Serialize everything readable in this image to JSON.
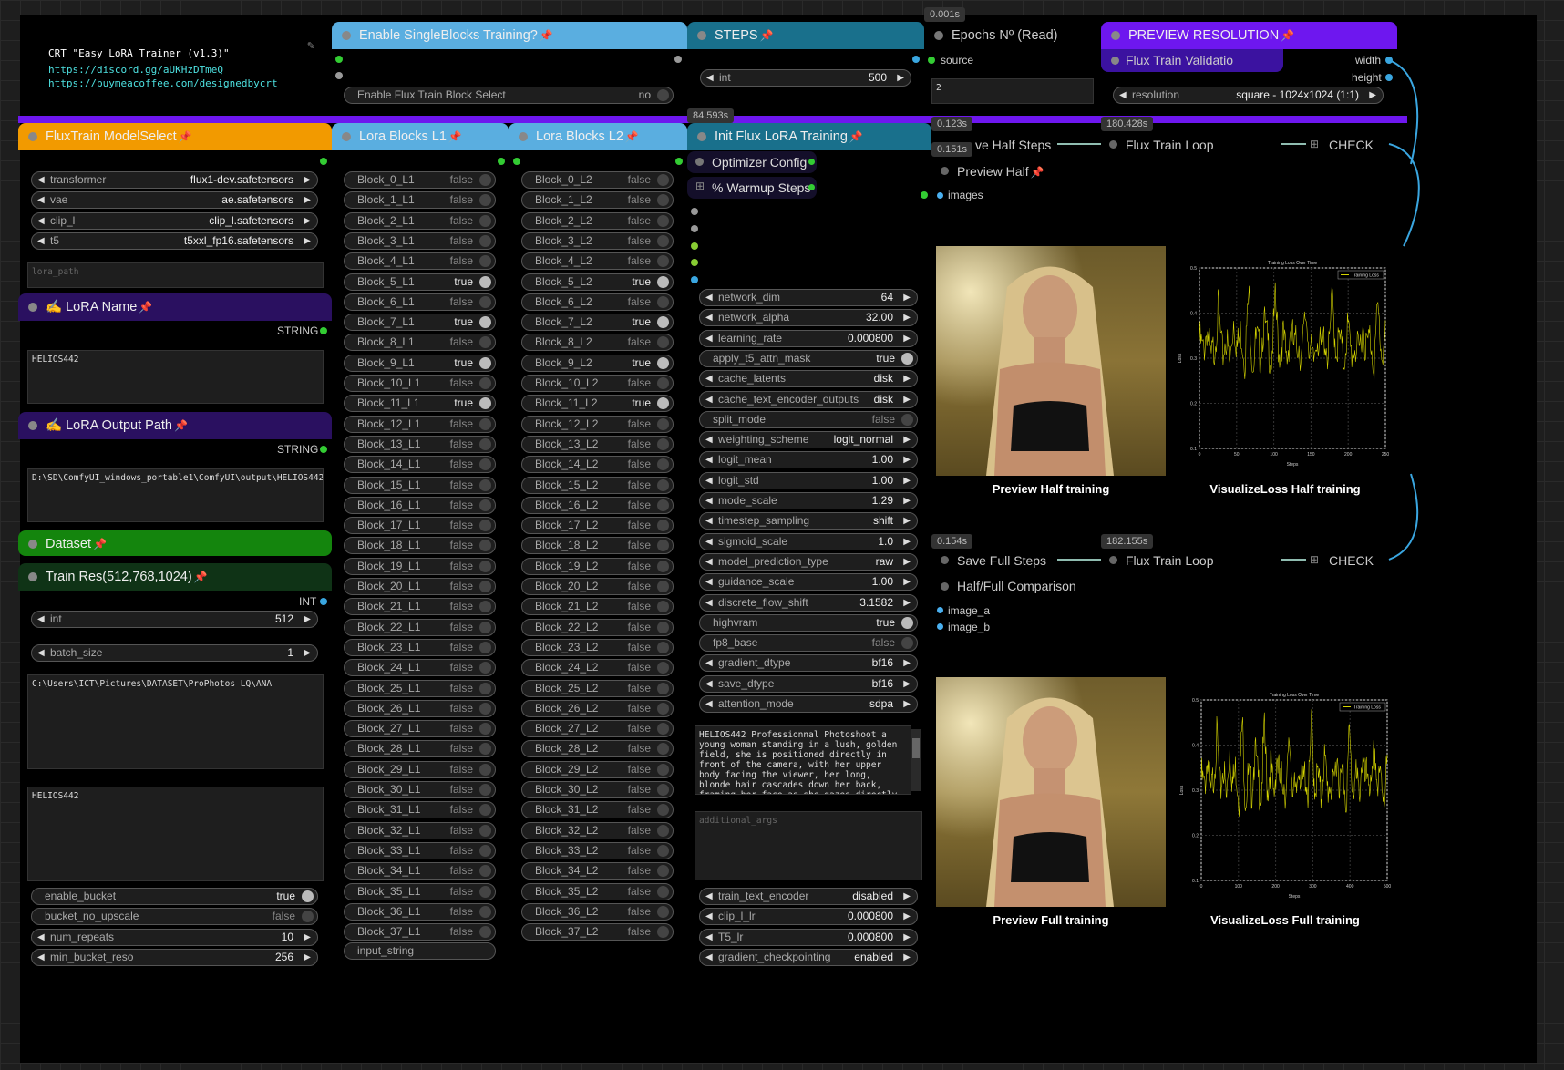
{
  "info": {
    "title": "CRT \"Easy LoRA Trainer (v1.3)\"",
    "link1": "https://discord.gg/aUKHzDTmeQ",
    "link2": "https://buymeacoffee.com/designedbycrt"
  },
  "timers": {
    "t1": "0.001s",
    "t2": "84.593s",
    "t3": "0.123s",
    "t4": "0.151s",
    "t5": "180.428s",
    "t6": "0.154s",
    "t7": "182.155s"
  },
  "singleblocks": {
    "title": "Enable SingleBlocks Training?",
    "select_label": "Enable Flux Train Block Select",
    "select_value": "no"
  },
  "steps": {
    "title": "STEPS",
    "label": "int",
    "value": "500"
  },
  "epochs": {
    "title": "Epochs Nº (Read)",
    "source": "source",
    "value": "2"
  },
  "preview_res": {
    "title": "PREVIEW RESOLUTION",
    "sub": "Flux Train Validatio",
    "width": "width",
    "height": "height",
    "res_label": "resolution",
    "res_value": "square - 1024x1024 (1:1)"
  },
  "modelselect": {
    "title": "FluxTrain ModelSelect",
    "rows": [
      {
        "label": "transformer",
        "value": "flux1-dev.safetensors"
      },
      {
        "label": "vae",
        "value": "ae.safetensors"
      },
      {
        "label": "clip_l",
        "value": "clip_l.safetensors"
      },
      {
        "label": "t5",
        "value": "t5xxl_fp16.safetensors"
      }
    ],
    "lora_path": "lora_path"
  },
  "lora_name": {
    "title": "LoRA Name",
    "type": "STRING",
    "value": "HELIOS442"
  },
  "lora_output": {
    "title": "LoRA Output Path",
    "type": "STRING",
    "value": "D:\\SD\\ComfyUI_windows_portable1\\ComfyUI\\output\\HELIOS442"
  },
  "dataset": {
    "title": "Dataset"
  },
  "trainres": {
    "title": "Train Res(512,768,1024)",
    "type": "INT",
    "int_label": "int",
    "int_value": "512",
    "batch_label": "batch_size",
    "batch_value": "1",
    "path": "C:\\Users\\ICT\\Pictures\\DATASET\\ProPhotos LQ\\ANA",
    "trigger": "HELIOS442",
    "enable_bucket": "enable_bucket",
    "enable_bucket_v": "true",
    "bucket_no_upscale": "bucket_no_upscale",
    "bucket_no_upscale_v": "false",
    "num_repeats": "num_repeats",
    "num_repeats_v": "10",
    "min_bucket_reso": "min_bucket_reso",
    "min_bucket_reso_v": "256"
  },
  "blocks_l1": {
    "title": "Lora Blocks L1",
    "input": "input_string",
    "items": [
      {
        "l": "Block_0_L1",
        "v": "false"
      },
      {
        "l": "Block_1_L1",
        "v": "false"
      },
      {
        "l": "Block_2_L1",
        "v": "false"
      },
      {
        "l": "Block_3_L1",
        "v": "false"
      },
      {
        "l": "Block_4_L1",
        "v": "false"
      },
      {
        "l": "Block_5_L1",
        "v": "true"
      },
      {
        "l": "Block_6_L1",
        "v": "false"
      },
      {
        "l": "Block_7_L1",
        "v": "true"
      },
      {
        "l": "Block_8_L1",
        "v": "false"
      },
      {
        "l": "Block_9_L1",
        "v": "true"
      },
      {
        "l": "Block_10_L1",
        "v": "false"
      },
      {
        "l": "Block_11_L1",
        "v": "true"
      },
      {
        "l": "Block_12_L1",
        "v": "false"
      },
      {
        "l": "Block_13_L1",
        "v": "false"
      },
      {
        "l": "Block_14_L1",
        "v": "false"
      },
      {
        "l": "Block_15_L1",
        "v": "false"
      },
      {
        "l": "Block_16_L1",
        "v": "false"
      },
      {
        "l": "Block_17_L1",
        "v": "false"
      },
      {
        "l": "Block_18_L1",
        "v": "false"
      },
      {
        "l": "Block_19_L1",
        "v": "false"
      },
      {
        "l": "Block_20_L1",
        "v": "false"
      },
      {
        "l": "Block_21_L1",
        "v": "false"
      },
      {
        "l": "Block_22_L1",
        "v": "false"
      },
      {
        "l": "Block_23_L1",
        "v": "false"
      },
      {
        "l": "Block_24_L1",
        "v": "false"
      },
      {
        "l": "Block_25_L1",
        "v": "false"
      },
      {
        "l": "Block_26_L1",
        "v": "false"
      },
      {
        "l": "Block_27_L1",
        "v": "false"
      },
      {
        "l": "Block_28_L1",
        "v": "false"
      },
      {
        "l": "Block_29_L1",
        "v": "false"
      },
      {
        "l": "Block_30_L1",
        "v": "false"
      },
      {
        "l": "Block_31_L1",
        "v": "false"
      },
      {
        "l": "Block_32_L1",
        "v": "false"
      },
      {
        "l": "Block_33_L1",
        "v": "false"
      },
      {
        "l": "Block_34_L1",
        "v": "false"
      },
      {
        "l": "Block_35_L1",
        "v": "false"
      },
      {
        "l": "Block_36_L1",
        "v": "false"
      },
      {
        "l": "Block_37_L1",
        "v": "false"
      }
    ]
  },
  "blocks_l2": {
    "title": "Lora Blocks L2",
    "items": [
      {
        "l": "Block_0_L2",
        "v": "false"
      },
      {
        "l": "Block_1_L2",
        "v": "false"
      },
      {
        "l": "Block_2_L2",
        "v": "false"
      },
      {
        "l": "Block_3_L2",
        "v": "false"
      },
      {
        "l": "Block_4_L2",
        "v": "false"
      },
      {
        "l": "Block_5_L2",
        "v": "true"
      },
      {
        "l": "Block_6_L2",
        "v": "false"
      },
      {
        "l": "Block_7_L2",
        "v": "true"
      },
      {
        "l": "Block_8_L2",
        "v": "false"
      },
      {
        "l": "Block_9_L2",
        "v": "true"
      },
      {
        "l": "Block_10_L2",
        "v": "false"
      },
      {
        "l": "Block_11_L2",
        "v": "true"
      },
      {
        "l": "Block_12_L2",
        "v": "false"
      },
      {
        "l": "Block_13_L2",
        "v": "false"
      },
      {
        "l": "Block_14_L2",
        "v": "false"
      },
      {
        "l": "Block_15_L2",
        "v": "false"
      },
      {
        "l": "Block_16_L2",
        "v": "false"
      },
      {
        "l": "Block_17_L2",
        "v": "false"
      },
      {
        "l": "Block_18_L2",
        "v": "false"
      },
      {
        "l": "Block_19_L2",
        "v": "false"
      },
      {
        "l": "Block_20_L2",
        "v": "false"
      },
      {
        "l": "Block_21_L2",
        "v": "false"
      },
      {
        "l": "Block_22_L2",
        "v": "false"
      },
      {
        "l": "Block_23_L2",
        "v": "false"
      },
      {
        "l": "Block_24_L2",
        "v": "false"
      },
      {
        "l": "Block_25_L2",
        "v": "false"
      },
      {
        "l": "Block_26_L2",
        "v": "false"
      },
      {
        "l": "Block_27_L2",
        "v": "false"
      },
      {
        "l": "Block_28_L2",
        "v": "false"
      },
      {
        "l": "Block_29_L2",
        "v": "false"
      },
      {
        "l": "Block_30_L2",
        "v": "false"
      },
      {
        "l": "Block_31_L2",
        "v": "false"
      },
      {
        "l": "Block_32_L2",
        "v": "false"
      },
      {
        "l": "Block_33_L2",
        "v": "false"
      },
      {
        "l": "Block_34_L2",
        "v": "false"
      },
      {
        "l": "Block_35_L2",
        "v": "false"
      },
      {
        "l": "Block_36_L2",
        "v": "false"
      },
      {
        "l": "Block_37_L2",
        "v": "false"
      }
    ]
  },
  "init": {
    "title": "Init Flux LoRA Training",
    "optimizer": "Optimizer Config",
    "warmup": "% Warmup Steps",
    "params": [
      {
        "l": "network_dim",
        "v": "64",
        "t": "num"
      },
      {
        "l": "network_alpha",
        "v": "32.00",
        "t": "num"
      },
      {
        "l": "learning_rate",
        "v": "0.000800",
        "t": "num"
      },
      {
        "l": "apply_t5_attn_mask",
        "v": "true",
        "t": "bool"
      },
      {
        "l": "cache_latents",
        "v": "disk",
        "t": "num"
      },
      {
        "l": "cache_text_encoder_outputs",
        "v": "disk",
        "t": "num"
      },
      {
        "l": "split_mode",
        "v": "false",
        "t": "bool"
      },
      {
        "l": "weighting_scheme",
        "v": "logit_normal",
        "t": "num"
      },
      {
        "l": "logit_mean",
        "v": "1.00",
        "t": "num"
      },
      {
        "l": "logit_std",
        "v": "1.00",
        "t": "num"
      },
      {
        "l": "mode_scale",
        "v": "1.29",
        "t": "num"
      },
      {
        "l": "timestep_sampling",
        "v": "shift",
        "t": "num"
      },
      {
        "l": "sigmoid_scale",
        "v": "1.0",
        "t": "num"
      },
      {
        "l": "model_prediction_type",
        "v": "raw",
        "t": "num"
      },
      {
        "l": "guidance_scale",
        "v": "1.00",
        "t": "num"
      },
      {
        "l": "discrete_flow_shift",
        "v": "3.1582",
        "t": "num"
      },
      {
        "l": "highvram",
        "v": "true",
        "t": "bool"
      },
      {
        "l": "fp8_base",
        "v": "false",
        "t": "bool"
      },
      {
        "l": "gradient_dtype",
        "v": "bf16",
        "t": "num"
      },
      {
        "l": "save_dtype",
        "v": "bf16",
        "t": "num"
      },
      {
        "l": "attention_mode",
        "v": "sdpa",
        "t": "num"
      }
    ],
    "prompt": "HELIOS442 Professionnal Photoshoot a young woman standing in a lush, golden field, she is positioned directly in front of the camera, with her upper body facing the viewer, her long, blonde hair cascades down her back, framing her face as she gazes directly at the viewer with a neutral",
    "additional": "additional_args",
    "params2": [
      {
        "l": "train_text_encoder",
        "v": "disabled"
      },
      {
        "l": "clip_l_lr",
        "v": "0.000800"
      },
      {
        "l": "T5_lr",
        "v": "0.000800"
      },
      {
        "l": "gradient_checkpointing",
        "v": "enabled"
      }
    ]
  },
  "half": {
    "save": "Save Half Steps",
    "save_visible": "ve Half Steps",
    "loop": "Flux Train Loop",
    "check": "CHECK",
    "preview": "Preview Half",
    "images": "images",
    "cap1": "Preview Half training",
    "cap2": "VisualizeLoss Half training",
    "chart_title": "Training Loss Over Time",
    "legend": "Training Loss",
    "ylabel": "Loss",
    "xlabel": "Steps"
  },
  "full": {
    "save": "Save Full Steps",
    "loop": "Flux Train Loop",
    "check": "CHECK",
    "compare": "Half/Full Comparison",
    "image_a": "image_a",
    "image_b": "image_b",
    "cap1": "Preview Full training",
    "cap2": "VisualizeLoss Full training"
  },
  "chart_data": [
    {
      "type": "line",
      "title": "Training Loss Over Time",
      "legend": [
        "Training Loss"
      ],
      "xlabel": "Steps",
      "ylabel": "Loss",
      "xlim": [
        0,
        250
      ],
      "ylim": [
        0.1,
        0.5
      ],
      "xticks": [
        "0",
        "50",
        "100",
        "150",
        "200",
        "250"
      ],
      "yticks": [
        "0.1",
        "0.2",
        "0.3",
        "0.4",
        "0.5"
      ],
      "series": [
        {
          "name": "Training Loss",
          "values": [
            0.34,
            0.31,
            0.37,
            0.29,
            0.33,
            0.41,
            0.3,
            0.35,
            0.28,
            0.39,
            0.32,
            0.36,
            0.3,
            0.44,
            0.29,
            0.34,
            0.31,
            0.38,
            0.33,
            0.3,
            0.42,
            0.31,
            0.35,
            0.29,
            0.37,
            0.32,
            0.34,
            0.3,
            0.4,
            0.33,
            0.28,
            0.36,
            0.31,
            0.35,
            0.3,
            0.43,
            0.32,
            0.34,
            0.29,
            0.37,
            0.31,
            0.33,
            0.3,
            0.38,
            0.32,
            0.35,
            0.29,
            0.41,
            0.31,
            0.34
          ]
        }
      ]
    },
    {
      "type": "line",
      "title": "Training Loss Over Time",
      "legend": [
        "Training Loss"
      ],
      "xlabel": "Steps",
      "ylabel": "Loss",
      "xlim": [
        0,
        500
      ],
      "ylim": [
        0.1,
        0.5
      ],
      "xticks": [
        "0",
        "100",
        "200",
        "300",
        "400",
        "500"
      ],
      "yticks": [
        "0.1",
        "0.2",
        "0.3",
        "0.4",
        "0.5"
      ],
      "series": [
        {
          "name": "Training Loss",
          "values": [
            0.33,
            0.3,
            0.38,
            0.28,
            0.34,
            0.42,
            0.29,
            0.36,
            0.27,
            0.4,
            0.31,
            0.35,
            0.29,
            0.45,
            0.28,
            0.33,
            0.3,
            0.39,
            0.32,
            0.29,
            0.43,
            0.3,
            0.36,
            0.28,
            0.38,
            0.31,
            0.33,
            0.29,
            0.41,
            0.32,
            0.27,
            0.37,
            0.3,
            0.34,
            0.29,
            0.44,
            0.31,
            0.33,
            0.28,
            0.38,
            0.3,
            0.32,
            0.29,
            0.39,
            0.31,
            0.34,
            0.28,
            0.42,
            0.3,
            0.33,
            0.29,
            0.37,
            0.31,
            0.35,
            0.28,
            0.4,
            0.3,
            0.33,
            0.29,
            0.36
          ]
        }
      ]
    }
  ],
  "colors": {
    "purple": "#6e17ef",
    "blue_hdr": "#5aaee0",
    "teal_hdr": "#19708c",
    "orange_hdr": "#f29a00",
    "green_hdr": "#14850d",
    "dark_purple": "#2a1060",
    "dark_green": "#0f3316"
  }
}
